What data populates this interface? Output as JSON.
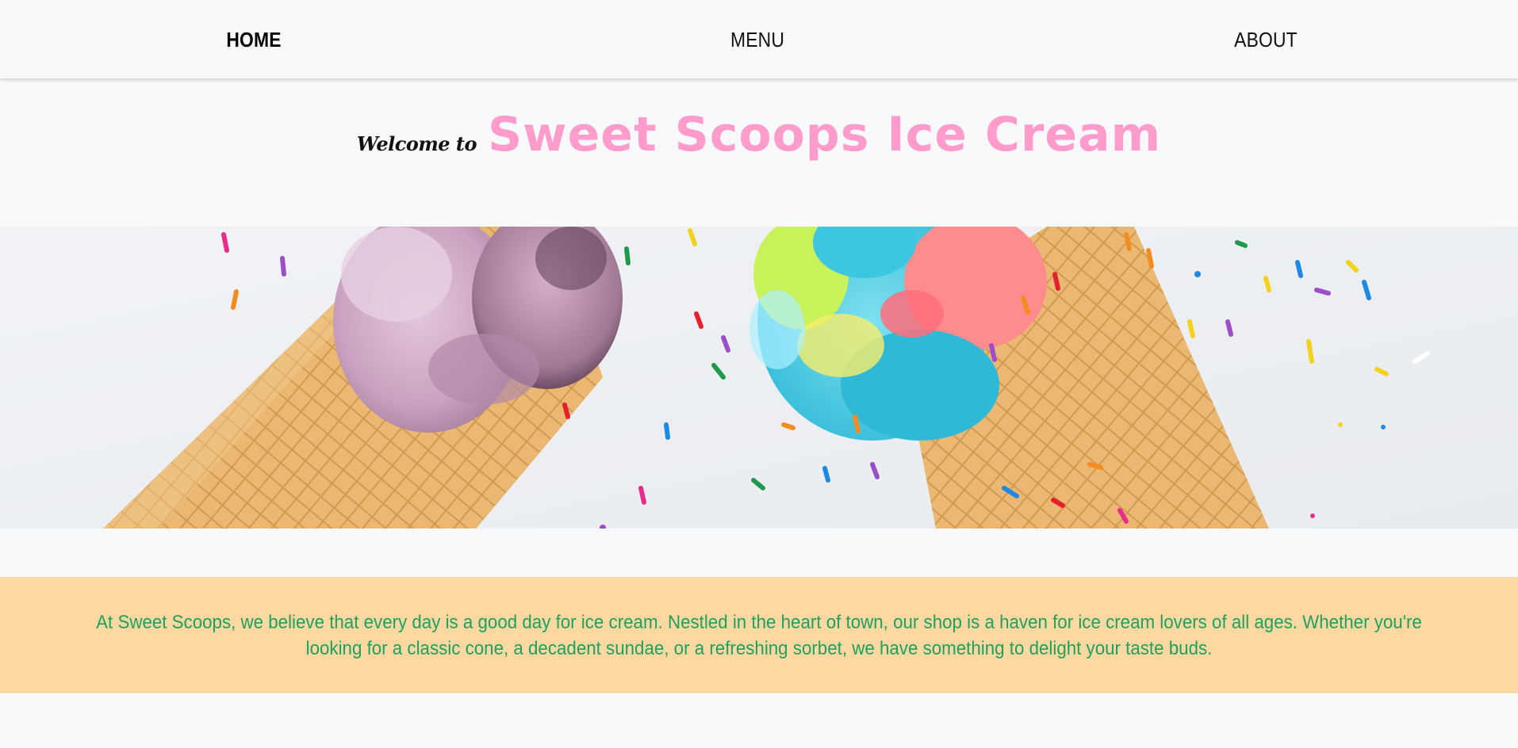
{
  "nav": {
    "items": [
      {
        "label": "HOME",
        "active": true
      },
      {
        "label": "MENU",
        "active": false
      },
      {
        "label": "ABOUT",
        "active": false
      }
    ]
  },
  "hero": {
    "welcome": "Welcome to",
    "brand": "Sweet Scoops Ice Cream"
  },
  "banner": {
    "image": "ice-cream-cones-with-sprinkles"
  },
  "about": {
    "text": "At Sweet Scoops, we believe that every day is a good day for ice cream. Nestled in the heart of town, our shop is a haven for ice cream lovers of all ages. Whether you're looking for a classic cone, a decadent sundae, or a refreshing sorbet, we have something to delight your taste buds."
  },
  "colors": {
    "background": "#f8f9fb",
    "brand_pink": "#ff9ccb",
    "about_band": "#fed8a1",
    "about_text": "#1ea15e"
  }
}
